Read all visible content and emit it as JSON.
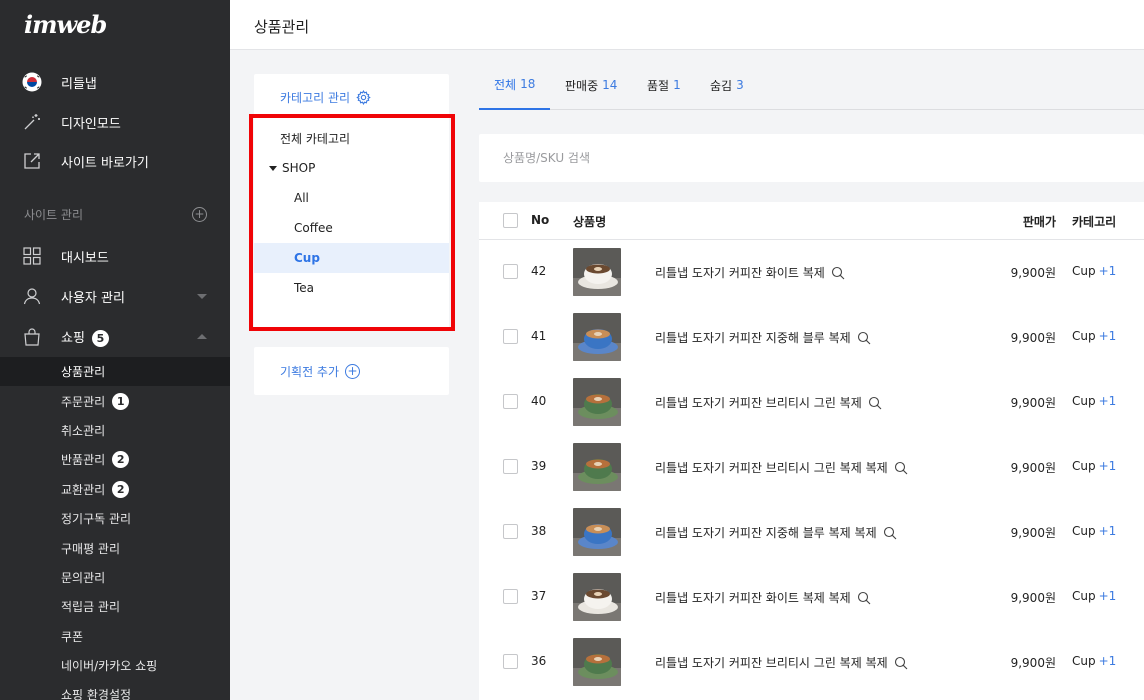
{
  "app": {
    "logo": "imweb"
  },
  "sidebar": {
    "top_items": [
      {
        "label": "리들냅",
        "icon": "korea-flag-icon"
      },
      {
        "label": "디자인모드",
        "icon": "magic-wand-icon"
      },
      {
        "label": "사이트 바로가기",
        "icon": "external-link-icon"
      }
    ],
    "section_label": "사이트 관리",
    "section_add": "+",
    "menu": [
      {
        "label": "대시보드",
        "icon": "grid-icon"
      },
      {
        "label": "사용자 관리",
        "icon": "user-icon"
      },
      {
        "label": "쇼핑",
        "icon": "shopping-bag-icon",
        "badge": "5"
      }
    ],
    "sub_items": [
      {
        "label": "상품관리",
        "active": true
      },
      {
        "label": "주문관리",
        "badge": "1"
      },
      {
        "label": "취소관리"
      },
      {
        "label": "반품관리",
        "badge": "2"
      },
      {
        "label": "교환관리",
        "badge": "2"
      },
      {
        "label": "정기구독 관리"
      },
      {
        "label": "구매평 관리"
      },
      {
        "label": "문의관리"
      },
      {
        "label": "적립금 관리"
      },
      {
        "label": "쿠폰"
      },
      {
        "label": "네이버/카카오 쇼핑"
      },
      {
        "label": "쇼핑 환경설정"
      }
    ]
  },
  "header": {
    "title": "상품관리"
  },
  "category_panel": {
    "title": "카테고리 관리",
    "items": [
      {
        "label": "전체 카테고리",
        "level": 0
      },
      {
        "label": "SHOP",
        "level": 0,
        "expanded": true
      },
      {
        "label": "All",
        "level": 1
      },
      {
        "label": "Coffee",
        "level": 1
      },
      {
        "label": "Cup",
        "level": 1,
        "active": true
      },
      {
        "label": "Tea",
        "level": 1
      }
    ],
    "event_add": "기획전 추가",
    "event_plus": "+"
  },
  "tabs": [
    {
      "label": "전체",
      "count": "18",
      "active": true
    },
    {
      "label": "판매중",
      "count": "14"
    },
    {
      "label": "품절",
      "count": "1"
    },
    {
      "label": "숨김",
      "count": "3"
    }
  ],
  "search": {
    "placeholder": "상품명/SKU 검색"
  },
  "table": {
    "headers": {
      "no": "No",
      "name": "상품명",
      "price": "판매가",
      "category": "카테고리"
    },
    "rows": [
      {
        "no": "42",
        "name": "리틀냅 도자기 커피잔 화이트 복제",
        "price": "9,900원",
        "category": "Cup",
        "extra": "+1",
        "thumb": "white"
      },
      {
        "no": "41",
        "name": "리틀냅 도자기 커피잔 지중해 블루 복제",
        "price": "9,900원",
        "category": "Cup",
        "extra": "+1",
        "thumb": "blue"
      },
      {
        "no": "40",
        "name": "리틀냅 도자기 커피잔 브리티시 그린 복제",
        "price": "9,900원",
        "category": "Cup",
        "extra": "+1",
        "thumb": "green"
      },
      {
        "no": "39",
        "name": "리틀냅 도자기 커피잔 브리티시 그린 복제 복제",
        "price": "9,900원",
        "category": "Cup",
        "extra": "+1",
        "thumb": "green"
      },
      {
        "no": "38",
        "name": "리틀냅 도자기 커피잔 지중해 블루 복제 복제",
        "price": "9,900원",
        "category": "Cup",
        "extra": "+1",
        "thumb": "blue"
      },
      {
        "no": "37",
        "name": "리틀냅 도자기 커피잔 화이트 복제 복제",
        "price": "9,900원",
        "category": "Cup",
        "extra": "+1",
        "thumb": "white"
      },
      {
        "no": "36",
        "name": "리틀냅 도자기 커피잔 브리티시 그린 복제 복제",
        "price": "9,900원",
        "category": "Cup",
        "extra": "+1",
        "thumb": "green"
      }
    ]
  },
  "colors": {
    "accent": "#2e74e6",
    "sidebar_bg": "#2b2c2e",
    "highlight": "#f00407"
  }
}
